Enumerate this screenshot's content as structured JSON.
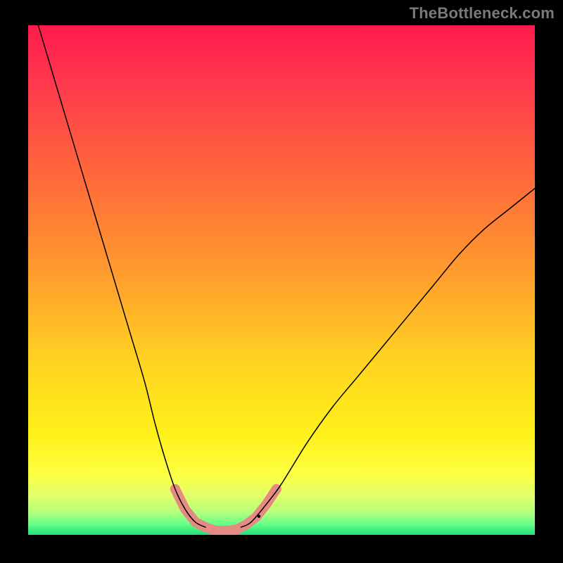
{
  "watermark": "TheBottleneck.com",
  "chart_data": {
    "type": "line",
    "title": "",
    "xlabel": "",
    "ylabel": "",
    "xlim": [
      0,
      100
    ],
    "ylim": [
      0,
      100
    ],
    "grid": false,
    "background_gradient": {
      "description": "vertical gradient top→bottom: red → orange → yellow → thin green band at bottom",
      "stops": [
        {
          "offset": 0.0,
          "color": "#ff1b4d"
        },
        {
          "offset": 0.12,
          "color": "#ff3a4d"
        },
        {
          "offset": 0.3,
          "color": "#ff6a3a"
        },
        {
          "offset": 0.48,
          "color": "#ff9a2e"
        },
        {
          "offset": 0.66,
          "color": "#ffd322"
        },
        {
          "offset": 0.8,
          "color": "#fff018"
        },
        {
          "offset": 0.88,
          "color": "#fdff42"
        },
        {
          "offset": 0.92,
          "color": "#e4ff68"
        },
        {
          "offset": 0.955,
          "color": "#b6ff7a"
        },
        {
          "offset": 0.978,
          "color": "#6bff86"
        },
        {
          "offset": 1.0,
          "color": "#1fe07a"
        }
      ]
    },
    "series": [
      {
        "name": "left-curve",
        "stroke": "#000000",
        "stroke_width": 1.5,
        "points": [
          {
            "x": 2,
            "y": 100
          },
          {
            "x": 5,
            "y": 90
          },
          {
            "x": 8,
            "y": 80
          },
          {
            "x": 11,
            "y": 70
          },
          {
            "x": 14,
            "y": 60
          },
          {
            "x": 17,
            "y": 50
          },
          {
            "x": 20,
            "y": 40
          },
          {
            "x": 23,
            "y": 30
          },
          {
            "x": 25,
            "y": 22
          },
          {
            "x": 27,
            "y": 15
          },
          {
            "x": 29,
            "y": 9
          },
          {
            "x": 31,
            "y": 5
          },
          {
            "x": 33,
            "y": 2.5
          },
          {
            "x": 35,
            "y": 1.5
          }
        ]
      },
      {
        "name": "right-curve",
        "stroke": "#000000",
        "stroke_width": 1.5,
        "points": [
          {
            "x": 42,
            "y": 1.5
          },
          {
            "x": 44,
            "y": 2.5
          },
          {
            "x": 47,
            "y": 6
          },
          {
            "x": 50,
            "y": 10
          },
          {
            "x": 55,
            "y": 18
          },
          {
            "x": 60,
            "y": 25
          },
          {
            "x": 65,
            "y": 31
          },
          {
            "x": 70,
            "y": 37
          },
          {
            "x": 75,
            "y": 43
          },
          {
            "x": 80,
            "y": 49
          },
          {
            "x": 85,
            "y": 55
          },
          {
            "x": 90,
            "y": 60
          },
          {
            "x": 95,
            "y": 64
          },
          {
            "x": 100,
            "y": 68
          }
        ]
      },
      {
        "name": "bottom-highlight",
        "stroke": "#e58b84",
        "stroke_width": 14,
        "points": [
          {
            "x": 29,
            "y": 9
          },
          {
            "x": 31,
            "y": 5
          },
          {
            "x": 33,
            "y": 2.5
          },
          {
            "x": 35,
            "y": 1.5
          },
          {
            "x": 37,
            "y": 0.8
          },
          {
            "x": 39,
            "y": 0.8
          },
          {
            "x": 41,
            "y": 1.0
          },
          {
            "x": 43,
            "y": 2.0
          },
          {
            "x": 45,
            "y": 3.5
          },
          {
            "x": 47,
            "y": 6
          },
          {
            "x": 49,
            "y": 9
          }
        ]
      }
    ],
    "annotations": []
  }
}
